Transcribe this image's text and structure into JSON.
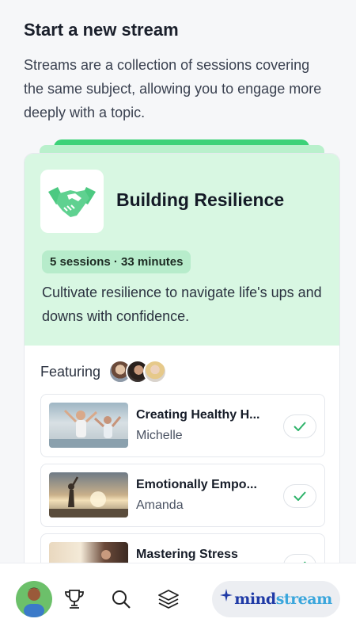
{
  "header": {
    "title": "Start a new stream",
    "description": "Streams are a collection of sessions covering the same subject, allowing you to engage more deeply with a topic."
  },
  "stream": {
    "name": "Building Resilience",
    "meta": "5 sessions · 33 minutes",
    "description": "Cultivate resilience to navigate life's ups and downs with confidence.",
    "icon": "handshake-icon",
    "featuring_label": "Featuring"
  },
  "sessions": [
    {
      "title": "Creating Healthy H...",
      "author": "Michelle",
      "completed": true
    },
    {
      "title": "Emotionally Empo...",
      "author": "Amanda",
      "completed": true
    },
    {
      "title": "Mastering Stress",
      "author": "",
      "completed": true
    }
  ],
  "nav": {
    "items": [
      "profile-avatar",
      "trophy-icon",
      "search-icon",
      "layers-icon"
    ],
    "brand_part1": "mind",
    "brand_part2": "stream"
  },
  "colors": {
    "accent_green": "#3cd278",
    "card_head_bg": "#d8f7e2",
    "pill_bg": "#b7eccb",
    "brand_blue": "#1f3aa6",
    "brand_light_blue": "#3aa6dc"
  }
}
